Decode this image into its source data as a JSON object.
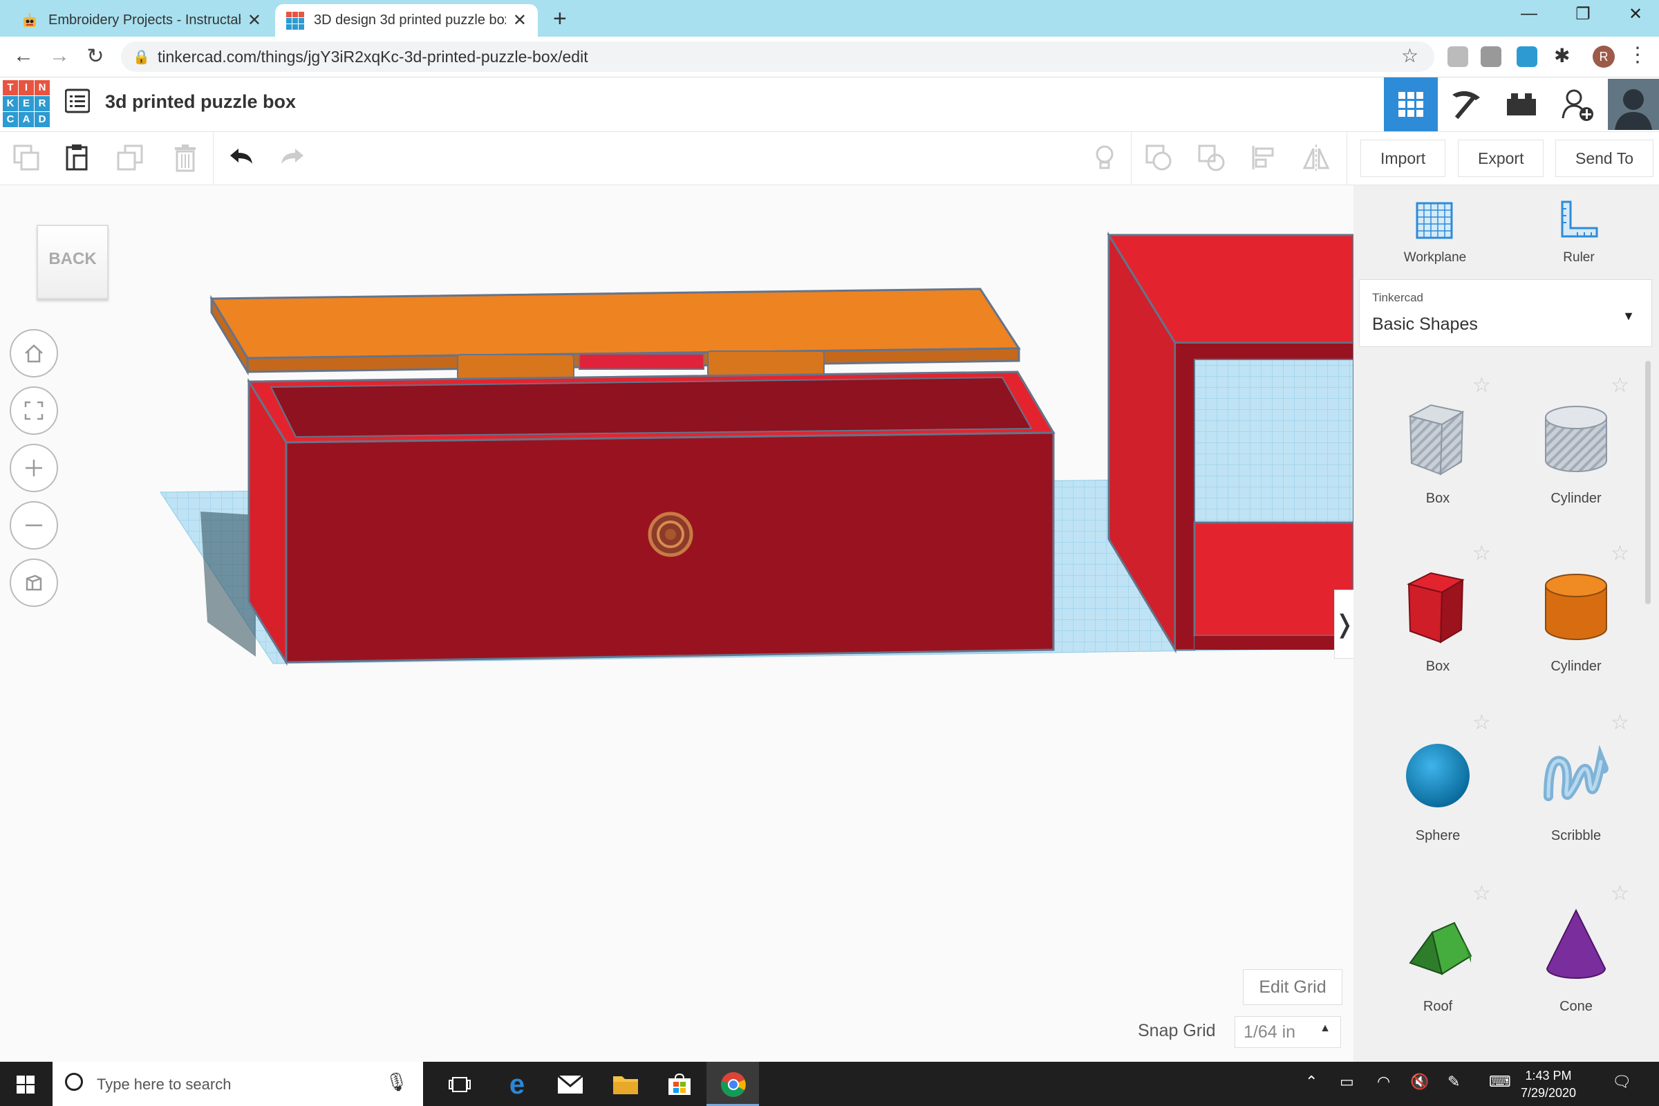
{
  "browser": {
    "tabs": [
      {
        "title": "Embroidery Projects - Instructables",
        "active": false
      },
      {
        "title": "3D design 3d printed puzzle box | Tinkercad",
        "active": true
      }
    ],
    "url": "tinkercad.com/things/jgY3iR2xqKc-3d-printed-puzzle-box/edit",
    "profile_initial": "R"
  },
  "app": {
    "logo_letters": [
      "T",
      "I",
      "N",
      "K",
      "E",
      "R",
      "C",
      "A",
      "D"
    ],
    "logo_colors": [
      "#e8543f",
      "#e8543f",
      "#e8543f",
      "#2d9bd2",
      "#2d9bd2",
      "#2d9bd2",
      "#2d9bd2",
      "#2d9bd2",
      "#2d9bd2"
    ],
    "design_title": "3d printed puzzle box",
    "accent": "#2e8bd8"
  },
  "toolbar": {
    "import_label": "Import",
    "export_label": "Export",
    "sendto_label": "Send To"
  },
  "viewcube": {
    "back_label": "BACK"
  },
  "grid": {
    "edit_grid_label": "Edit Grid",
    "snap_label": "Snap Grid",
    "snap_value": "1/64 in"
  },
  "panel": {
    "workplane_label": "Workplane",
    "ruler_label": "Ruler",
    "library_small": "Tinkercad",
    "library_name": "Basic Shapes",
    "shapes": [
      {
        "label": "Box",
        "icon": "box-hole-icon"
      },
      {
        "label": "Cylinder",
        "icon": "cylinder-hole-icon"
      },
      {
        "label": "Box",
        "icon": "box-icon"
      },
      {
        "label": "Cylinder",
        "icon": "cylinder-icon"
      },
      {
        "label": "Sphere",
        "icon": "sphere-icon"
      },
      {
        "label": "Scribble",
        "icon": "scribble-icon"
      },
      {
        "label": "Roof",
        "icon": "roof-icon"
      },
      {
        "label": "Cone",
        "icon": "cone-icon"
      }
    ]
  },
  "taskbar": {
    "search_placeholder": "Type here to search",
    "time": "1:43 PM",
    "date": "7/29/2020"
  }
}
